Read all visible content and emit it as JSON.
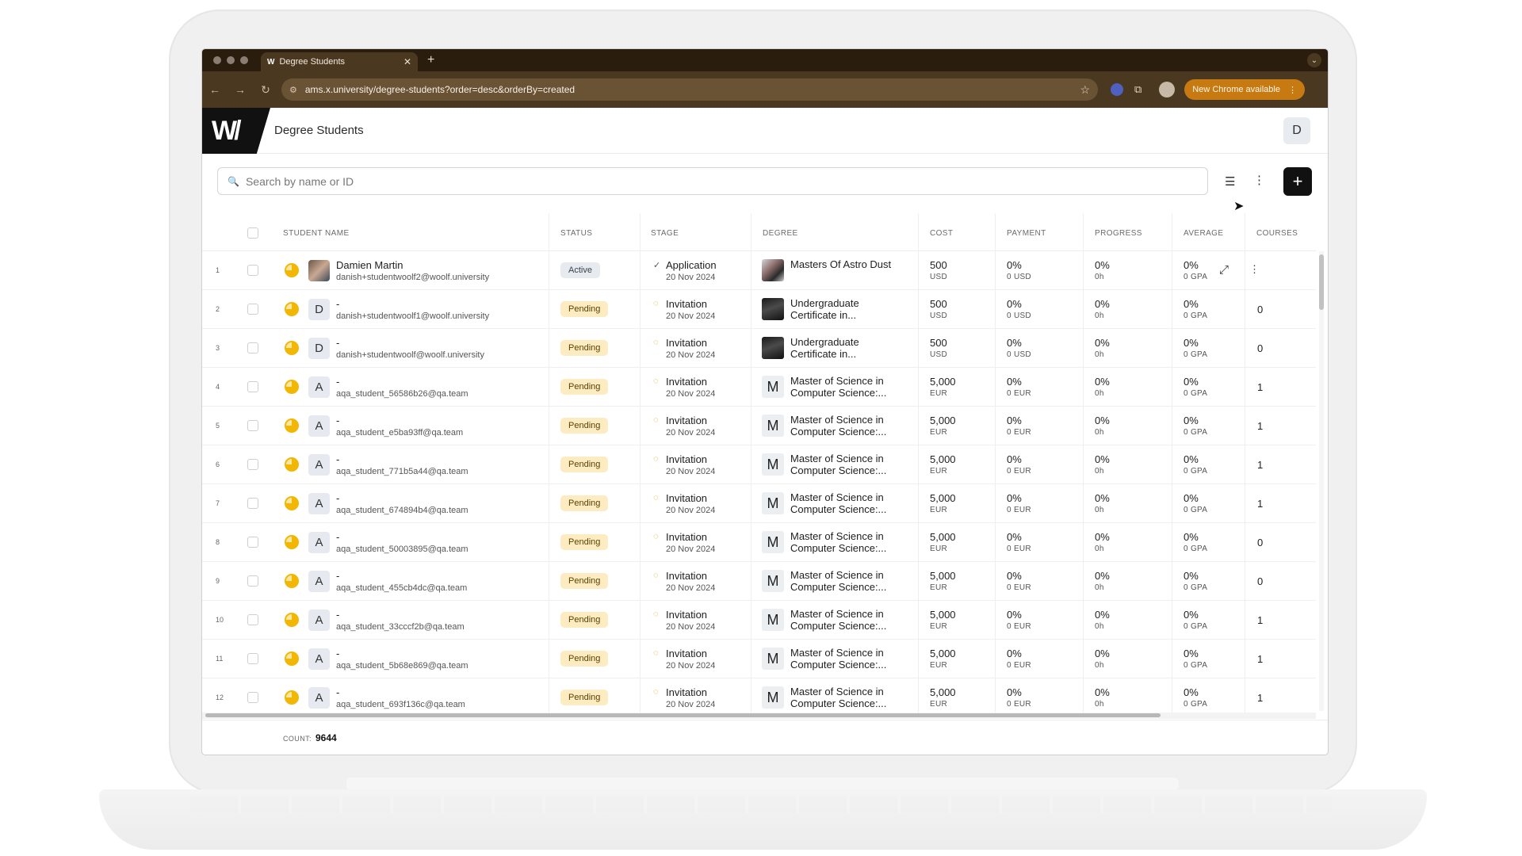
{
  "browser": {
    "tab_title": "Degree Students",
    "tab_favicon": "W",
    "url": "ams.x.university/degree-students?order=desc&orderBy=created",
    "new_chrome_label": "New Chrome available"
  },
  "app": {
    "title": "Degree Students",
    "logo_text": "W/",
    "user_initial": "D"
  },
  "search": {
    "placeholder": "Search by name or ID"
  },
  "columns": {
    "student_name": "STUDENT NAME",
    "status": "STATUS",
    "stage": "STAGE",
    "degree": "DEGREE",
    "cost": "COST",
    "payment": "PAYMENT",
    "progress": "PROGRESS",
    "average": "AVERAGE",
    "courses": "COURSES"
  },
  "rows": [
    {
      "num": "1",
      "avatar": "",
      "name": "Damien Martin",
      "email": "danish+studentwoolf2@woolf.university",
      "status": "Active",
      "stage": "Application",
      "stage_date": "20 Nov 2024",
      "degree_icon": "",
      "degree": "Masters Of Astro Dust",
      "cost": "500",
      "cost_cur": "USD",
      "payment": "0%",
      "payment_sub": "0 USD",
      "progress": "0%",
      "progress_sub": "0h",
      "average": "0%",
      "average_sub": "0 GPA",
      "courses": ""
    },
    {
      "num": "2",
      "avatar": "D",
      "name": "-",
      "email": "danish+studentwoolf1@woolf.university",
      "status": "Pending",
      "stage": "Invitation",
      "stage_date": "20 Nov 2024",
      "degree_icon": "",
      "degree": "Undergraduate Certificate in...",
      "cost": "500",
      "cost_cur": "USD",
      "payment": "0%",
      "payment_sub": "0 USD",
      "progress": "0%",
      "progress_sub": "0h",
      "average": "0%",
      "average_sub": "0 GPA",
      "courses": "0"
    },
    {
      "num": "3",
      "avatar": "D",
      "name": "-",
      "email": "danish+studentwoolf@woolf.university",
      "status": "Pending",
      "stage": "Invitation",
      "stage_date": "20 Nov 2024",
      "degree_icon": "",
      "degree": "Undergraduate Certificate in...",
      "cost": "500",
      "cost_cur": "USD",
      "payment": "0%",
      "payment_sub": "0 USD",
      "progress": "0%",
      "progress_sub": "0h",
      "average": "0%",
      "average_sub": "0 GPA",
      "courses": "0"
    },
    {
      "num": "4",
      "avatar": "A",
      "name": "-",
      "email": "aqa_student_56586b26@qa.team",
      "status": "Pending",
      "stage": "Invitation",
      "stage_date": "20 Nov 2024",
      "degree_icon": "M",
      "degree": "Master of Science in Computer Science:...",
      "cost": "5,000",
      "cost_cur": "EUR",
      "payment": "0%",
      "payment_sub": "0 EUR",
      "progress": "0%",
      "progress_sub": "0h",
      "average": "0%",
      "average_sub": "0 GPA",
      "courses": "1"
    },
    {
      "num": "5",
      "avatar": "A",
      "name": "-",
      "email": "aqa_student_e5ba93ff@qa.team",
      "status": "Pending",
      "stage": "Invitation",
      "stage_date": "20 Nov 2024",
      "degree_icon": "M",
      "degree": "Master of Science in Computer Science:...",
      "cost": "5,000",
      "cost_cur": "EUR",
      "payment": "0%",
      "payment_sub": "0 EUR",
      "progress": "0%",
      "progress_sub": "0h",
      "average": "0%",
      "average_sub": "0 GPA",
      "courses": "1"
    },
    {
      "num": "6",
      "avatar": "A",
      "name": "-",
      "email": "aqa_student_771b5a44@qa.team",
      "status": "Pending",
      "stage": "Invitation",
      "stage_date": "20 Nov 2024",
      "degree_icon": "M",
      "degree": "Master of Science in Computer Science:...",
      "cost": "5,000",
      "cost_cur": "EUR",
      "payment": "0%",
      "payment_sub": "0 EUR",
      "progress": "0%",
      "progress_sub": "0h",
      "average": "0%",
      "average_sub": "0 GPA",
      "courses": "1"
    },
    {
      "num": "7",
      "avatar": "A",
      "name": "-",
      "email": "aqa_student_674894b4@qa.team",
      "status": "Pending",
      "stage": "Invitation",
      "stage_date": "20 Nov 2024",
      "degree_icon": "M",
      "degree": "Master of Science in Computer Science:...",
      "cost": "5,000",
      "cost_cur": "EUR",
      "payment": "0%",
      "payment_sub": "0 EUR",
      "progress": "0%",
      "progress_sub": "0h",
      "average": "0%",
      "average_sub": "0 GPA",
      "courses": "1"
    },
    {
      "num": "8",
      "avatar": "A",
      "name": "-",
      "email": "aqa_student_50003895@qa.team",
      "status": "Pending",
      "stage": "Invitation",
      "stage_date": "20 Nov 2024",
      "degree_icon": "M",
      "degree": "Master of Science in Computer Science:...",
      "cost": "5,000",
      "cost_cur": "EUR",
      "payment": "0%",
      "payment_sub": "0 EUR",
      "progress": "0%",
      "progress_sub": "0h",
      "average": "0%",
      "average_sub": "0 GPA",
      "courses": "0"
    },
    {
      "num": "9",
      "avatar": "A",
      "name": "-",
      "email": "aqa_student_455cb4dc@qa.team",
      "status": "Pending",
      "stage": "Invitation",
      "stage_date": "20 Nov 2024",
      "degree_icon": "M",
      "degree": "Master of Science in Computer Science:...",
      "cost": "5,000",
      "cost_cur": "EUR",
      "payment": "0%",
      "payment_sub": "0 EUR",
      "progress": "0%",
      "progress_sub": "0h",
      "average": "0%",
      "average_sub": "0 GPA",
      "courses": "0"
    },
    {
      "num": "10",
      "avatar": "A",
      "name": "-",
      "email": "aqa_student_33cccf2b@qa.team",
      "status": "Pending",
      "stage": "Invitation",
      "stage_date": "20 Nov 2024",
      "degree_icon": "M",
      "degree": "Master of Science in Computer Science:...",
      "cost": "5,000",
      "cost_cur": "EUR",
      "payment": "0%",
      "payment_sub": "0 EUR",
      "progress": "0%",
      "progress_sub": "0h",
      "average": "0%",
      "average_sub": "0 GPA",
      "courses": "1"
    },
    {
      "num": "11",
      "avatar": "A",
      "name": "-",
      "email": "aqa_student_5b68e869@qa.team",
      "status": "Pending",
      "stage": "Invitation",
      "stage_date": "20 Nov 2024",
      "degree_icon": "M",
      "degree": "Master of Science in Computer Science:...",
      "cost": "5,000",
      "cost_cur": "EUR",
      "payment": "0%",
      "payment_sub": "0 EUR",
      "progress": "0%",
      "progress_sub": "0h",
      "average": "0%",
      "average_sub": "0 GPA",
      "courses": "1"
    },
    {
      "num": "12",
      "avatar": "A",
      "name": "-",
      "email": "aqa_student_693f136c@qa.team",
      "status": "Pending",
      "stage": "Invitation",
      "stage_date": "20 Nov 2024",
      "degree_icon": "M",
      "degree": "Master of Science in Computer Science:...",
      "cost": "5,000",
      "cost_cur": "EUR",
      "payment": "0%",
      "payment_sub": "0 EUR",
      "progress": "0%",
      "progress_sub": "0h",
      "average": "0%",
      "average_sub": "0 GPA",
      "courses": "1"
    }
  ],
  "footer": {
    "count_label": "COUNT:",
    "count": "9644"
  },
  "colors": {
    "pending_bg": "#fdebc2",
    "active_bg": "#e7ebef",
    "accent_dark": "#111111",
    "chrome_tab": "#4a3820"
  },
  "icons": [
    "search-icon",
    "filter-icon",
    "more-vertical-icon",
    "plus-icon",
    "expand-icon",
    "check-icon",
    "spinner-icon",
    "star-icon",
    "back-arrow-icon",
    "forward-arrow-icon",
    "reload-icon"
  ]
}
